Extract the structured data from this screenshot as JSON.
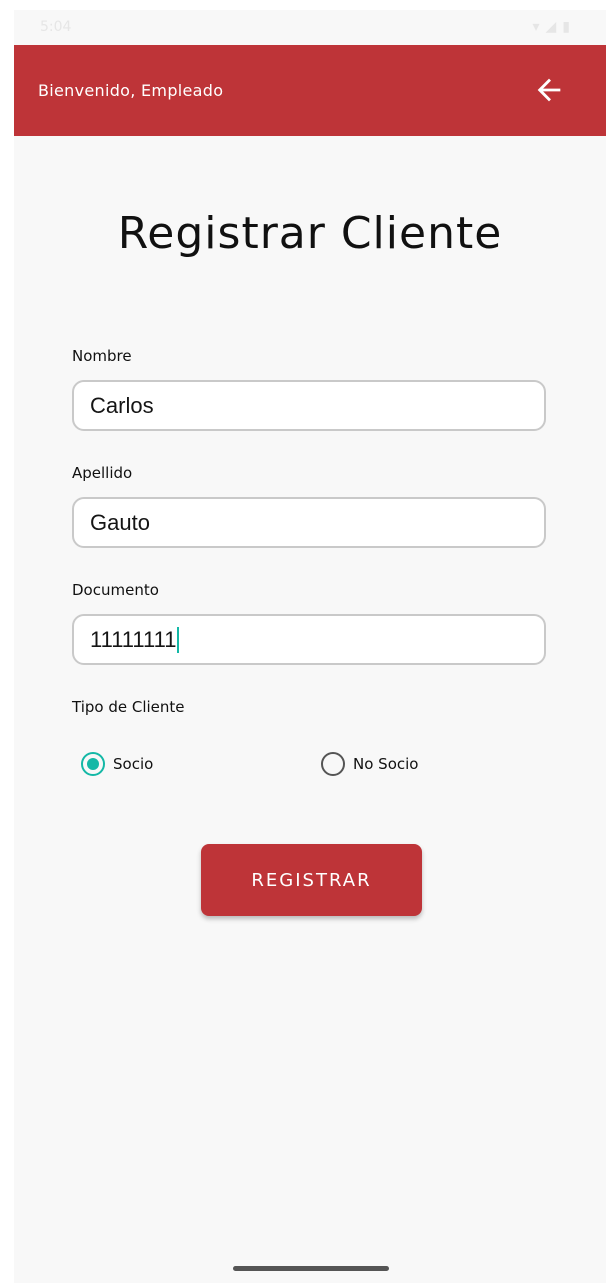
{
  "status_bar": {
    "time": "5:04",
    "icons": [
      "cast-icon",
      "sd-card-icon",
      "wifi-icon",
      "signal-icon",
      "battery-icon"
    ]
  },
  "app_bar": {
    "title": "Bienvenido, Empleado",
    "back_icon": "arrow-left-icon",
    "background": "#be3438"
  },
  "page": {
    "title": "Registrar Cliente"
  },
  "form": {
    "nombre": {
      "label": "Nombre",
      "value": "Carlos"
    },
    "apellido": {
      "label": "Apellido",
      "value": "Gauto"
    },
    "documento": {
      "label": "Documento",
      "value": "11111111"
    },
    "tipo_cliente": {
      "label": "Tipo de Cliente",
      "options": [
        {
          "label": "Socio",
          "selected": true
        },
        {
          "label": "No Socio",
          "selected": false
        }
      ]
    },
    "submit_label": "REGISTRAR"
  },
  "colors": {
    "accent": "#be3438",
    "radio_selected": "#14b8a6"
  }
}
